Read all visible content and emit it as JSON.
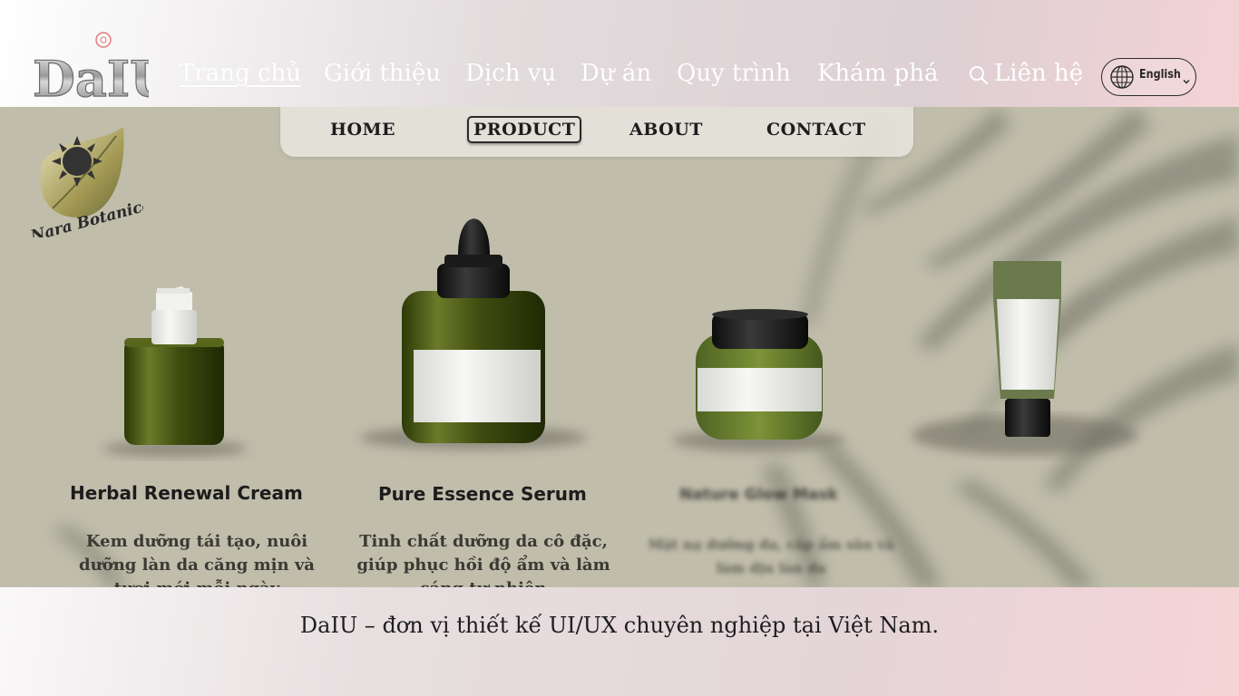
{
  "header": {
    "logo_text": "DaIU",
    "nav": [
      {
        "label": "Trang chủ",
        "active": true
      },
      {
        "label": "Giới thiệu",
        "active": false
      },
      {
        "label": "Dịch vụ",
        "active": false
      },
      {
        "label": "Dự án",
        "active": false
      },
      {
        "label": "Quy trình",
        "active": false
      },
      {
        "label": "Khám phá",
        "active": false
      }
    ],
    "contact_label": "Liên hệ",
    "language": "English"
  },
  "hero": {
    "brand_name": "Nara Botanica",
    "mock_nav": [
      "HOME",
      "PRODUCT",
      "ABOUT",
      "CONTACT"
    ],
    "mock_nav_active": "PRODUCT",
    "products": [
      {
        "name": "Herbal Renewal Cream",
        "desc": "Kem dưỡng tái tạo, nuôi dưỡng làn da căng mịn và tươi mới mỗi ngày"
      },
      {
        "name": "Pure Essence Serum",
        "desc": "Tinh chất dưỡng da cô đặc, giúp phục hồi độ ẩm và làm sáng tự nhiên"
      },
      {
        "name": "Nature Glow Mask",
        "desc": "Mặt nạ dưỡng da, cấp ẩm sâu và làm dịu làn da"
      }
    ]
  },
  "caption": "DaIU – đơn vị thiết kế UI/UX chuyên nghiệp tại Việt Nam.",
  "colors": {
    "hero_bg": "#c1bead",
    "bottle_green": "#4d5a18",
    "tube_green": "#6b7a4c"
  }
}
